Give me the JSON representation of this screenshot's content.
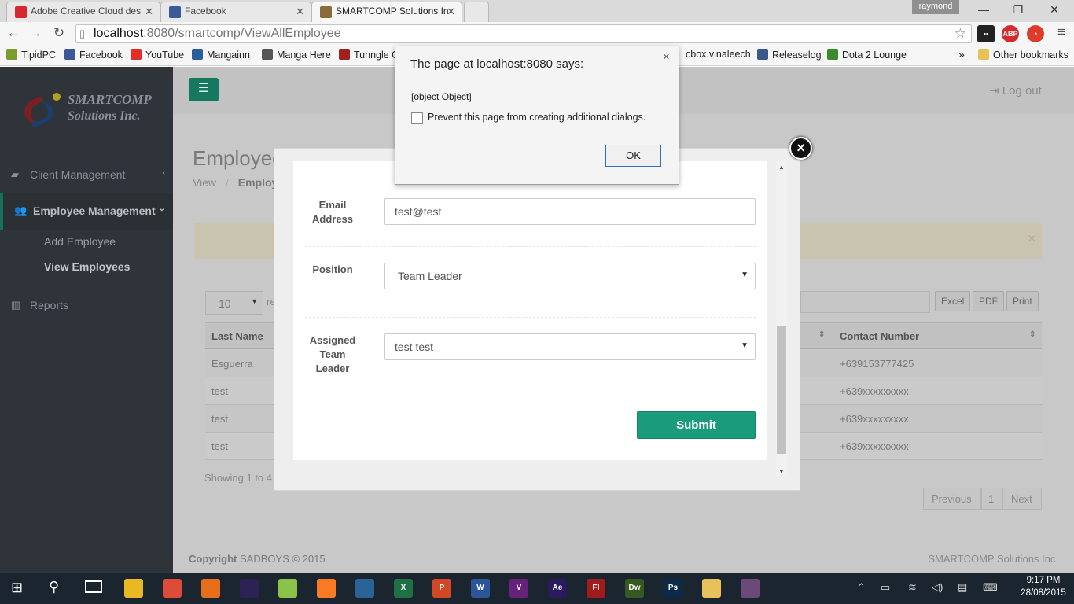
{
  "browser": {
    "tabs": [
      {
        "title": "Adobe Creative Cloud des",
        "icon": "adobe-icon",
        "color": "#d7282f"
      },
      {
        "title": "Facebook",
        "icon": "facebook-icon",
        "color": "#3b5998"
      },
      {
        "title": "SMARTCOMP Solutions In",
        "icon": "page-icon",
        "color": "#8a6a3a"
      }
    ],
    "user": "raymond",
    "url_host": "localhost",
    "url_path": ":8080/smartcomp/ViewAllEmployee",
    "bookmarks": [
      {
        "label": "TipidPC",
        "color": "#7a9c2e"
      },
      {
        "label": "Facebook",
        "color": "#3b5998"
      },
      {
        "label": "YouTube",
        "color": "#e52d27"
      },
      {
        "label": "Mangainn",
        "color": "#2a5f9e"
      },
      {
        "label": "Manga Here",
        "color": "#555555"
      },
      {
        "label": "Tunngle G",
        "color": "#a0201e"
      },
      {
        "label": "cbox.vinaleech",
        "color": "#d38b1c"
      },
      {
        "label": "Releaselog",
        "color": "#3a5a8c"
      },
      {
        "label": "Dota 2 Lounge",
        "color": "#3b8a2e"
      }
    ],
    "bookmarks_more": "»",
    "other_bookmarks": "Other bookmarks"
  },
  "sidebar": {
    "logo_line1": "SMARTCOMP",
    "logo_line2": "Solutions Inc.",
    "items": [
      {
        "label": "Client Management"
      },
      {
        "label": "Employee Management"
      },
      {
        "label": "Reports"
      }
    ],
    "subitems": [
      {
        "label": "Add Employee"
      },
      {
        "label": "View Employees"
      }
    ]
  },
  "header": {
    "logout": "Log out"
  },
  "page": {
    "title": "Employee",
    "breadcrumb_view": "View",
    "breadcrumb_sep": "/",
    "breadcrumb_current": "Employ"
  },
  "table": {
    "page_size": "10",
    "page_size_suffix": "re",
    "buttons": [
      "Excel",
      "PDF",
      "Print"
    ],
    "headers": {
      "last_name": "Last Name",
      "contact": "Contact Number"
    },
    "rows": [
      {
        "last_name": "Esguerra",
        "contact": "+639153777425"
      },
      {
        "last_name": "test",
        "contact": "+639xxxxxxxxx"
      },
      {
        "last_name": "test",
        "contact": "+639xxxxxxxxx"
      },
      {
        "last_name": "test",
        "contact": "+639xxxxxxxxx"
      }
    ],
    "showing": "Showing 1 to 4",
    "pagination": {
      "previous": "Previous",
      "page": "1",
      "next": "Next"
    }
  },
  "footer": {
    "copyright_bold": "Copyright",
    "copyright_rest": "SADBOYS © 2015",
    "company": "SMARTCOMP Solutions Inc."
  },
  "modal": {
    "email_label_1": "Email",
    "email_label_2": "Address",
    "email_value": "test@test",
    "position_label": "Position",
    "position_value": "Team Leader",
    "team_label_1": "Assigned",
    "team_label_2": "Team",
    "team_label_3": "Leader",
    "team_value": "test test",
    "submit": "Submit",
    "close": "×"
  },
  "alert": {
    "title": "The page at localhost:8080 says:",
    "message": "[object Object]",
    "checkbox_label": "Prevent this page from creating additional dialogs.",
    "ok": "OK",
    "close": "×"
  },
  "taskbar": {
    "time": "9:17 PM",
    "date": "28/08/2015",
    "apps": [
      {
        "name": "file-explorer",
        "label": "",
        "color": "#e8b923"
      },
      {
        "name": "chrome",
        "label": "",
        "color": "#dd4b39"
      },
      {
        "name": "firefox",
        "label": "",
        "color": "#e76f1c"
      },
      {
        "name": "eclipse",
        "label": "",
        "color": "#2c2255"
      },
      {
        "name": "notepadpp",
        "label": "",
        "color": "#8bc34a"
      },
      {
        "name": "xampp",
        "label": "",
        "color": "#fb7a24"
      },
      {
        "name": "mysql-workbench",
        "label": "",
        "color": "#2a6496"
      },
      {
        "name": "excel",
        "label": "X",
        "color": "#1e7145"
      },
      {
        "name": "powerpoint",
        "label": "P",
        "color": "#d24726"
      },
      {
        "name": "word",
        "label": "W",
        "color": "#2b579a"
      },
      {
        "name": "visual-studio",
        "label": "V",
        "color": "#68217a"
      },
      {
        "name": "after-effects",
        "label": "Ae",
        "color": "#2a1a5e"
      },
      {
        "name": "flash",
        "label": "Fl",
        "color": "#a01c1c"
      },
      {
        "name": "dreamweaver",
        "label": "Dw",
        "color": "#35591e"
      },
      {
        "name": "photoshop",
        "label": "Ps",
        "color": "#0b2a4a"
      },
      {
        "name": "folder",
        "label": "",
        "color": "#e8c15a"
      },
      {
        "name": "game-app",
        "label": "",
        "color": "#6b4a7a"
      }
    ]
  }
}
